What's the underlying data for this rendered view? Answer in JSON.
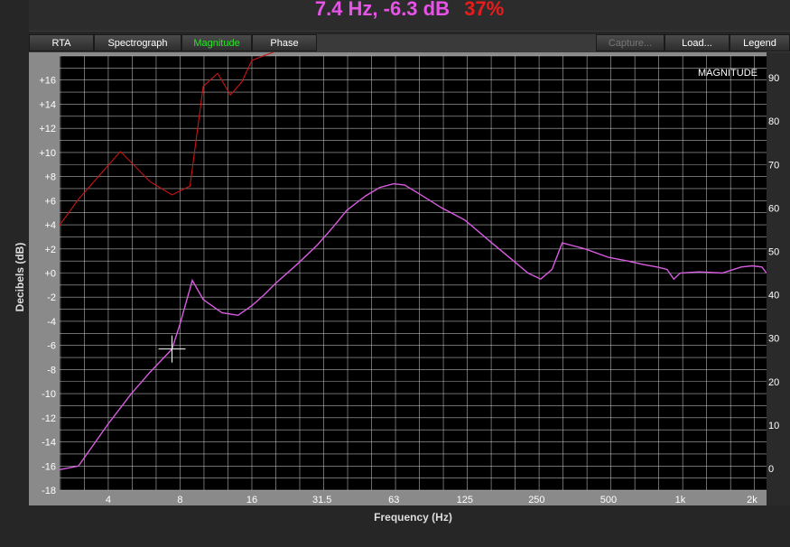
{
  "readout": {
    "freq_db": "7.4 Hz, -6.3 dB",
    "percent": "37%"
  },
  "tabs": [
    {
      "label": "RTA",
      "state": "normal"
    },
    {
      "label": "Spectrograph",
      "state": "normal"
    },
    {
      "label": "Magnitude",
      "state": "active"
    },
    {
      "label": "Phase",
      "state": "normal"
    },
    {
      "label": "Capture...",
      "state": "disabled"
    },
    {
      "label": "Load...",
      "state": "normal"
    },
    {
      "label": "Legend",
      "state": "normal"
    }
  ],
  "plot": {
    "title": "MAGNITUDE",
    "xlabel": "Frequency (Hz)",
    "ylabel": "Decibels (dB)"
  },
  "colors": {
    "magnitude": "#d85ce0",
    "coherence": "#c81414",
    "grid": "#d0d0d0",
    "plot_bg": "#000000",
    "cursor": "#ffffff"
  },
  "chart_data": {
    "type": "line",
    "x_scale": "log",
    "xlim": [
      2.5,
      2300
    ],
    "ylim": [
      -18,
      18
    ],
    "y2lim": [
      -5,
      95
    ],
    "x_tick_labels": [
      "4",
      "8",
      "16",
      "31.5",
      "63",
      "125",
      "250",
      "500",
      "1k",
      "2k"
    ],
    "x_tick_values": [
      4,
      8,
      16,
      31.5,
      63,
      125,
      250,
      500,
      1000,
      2000
    ],
    "y_ticks": [
      16,
      14,
      12,
      10,
      8,
      6,
      4,
      2,
      0,
      -2,
      -4,
      -6,
      -8,
      -10,
      -12,
      -14,
      -16,
      -18
    ],
    "y_tick_labels": [
      "+16",
      "+14",
      "+12",
      "+10",
      "+8",
      "+6",
      "+4",
      "+2",
      "+0",
      "-2",
      "-4",
      "-6",
      "-8",
      "-10",
      "-12",
      "-14",
      "-16",
      "-18"
    ],
    "y2_ticks": [
      90,
      80,
      70,
      60,
      50,
      40,
      30,
      20,
      10,
      0
    ],
    "y2_tick_labels": [
      "90",
      "80",
      "70",
      "60",
      "50",
      "40",
      "30",
      "20",
      "10",
      "0"
    ],
    "grid": true,
    "cursor": {
      "x": 7.4,
      "y": -6.3
    },
    "series": [
      {
        "axis": "left",
        "x": [
          2.5,
          3,
          4,
          5,
          6,
          7.4,
          8,
          9,
          10,
          12,
          13,
          14,
          16,
          18,
          20,
          25,
          30,
          35,
          40,
          48,
          55,
          63,
          70,
          80,
          100,
          125,
          160,
          200,
          230,
          260,
          290,
          320,
          400,
          500,
          600,
          700,
          800,
          880,
          940,
          1000,
          1200,
          1500,
          1800,
          2000,
          2200,
          2300
        ],
        "y": [
          -16.3,
          -16.0,
          -12.5,
          -10.0,
          -8.2,
          -6.3,
          -4.2,
          -0.6,
          -2.2,
          -3.3,
          -3.4,
          -3.5,
          -2.7,
          -1.8,
          -0.9,
          0.8,
          2.3,
          3.8,
          5.2,
          6.4,
          7.1,
          7.4,
          7.3,
          6.6,
          5.4,
          4.4,
          2.6,
          1.0,
          0.0,
          -0.5,
          0.3,
          2.5,
          2.0,
          1.3,
          1.0,
          0.7,
          0.5,
          0.3,
          -0.5,
          0.0,
          0.1,
          0.0,
          0.5,
          0.6,
          0.5,
          0.0
        ]
      },
      {
        "axis": "right",
        "x": [
          2.5,
          3,
          4.5,
          6,
          7.4,
          8.8,
          10,
          11.5,
          13,
          14.5,
          16,
          20,
          30,
          50,
          100,
          300,
          1000,
          2300
        ],
        "y": [
          56,
          62,
          73,
          66,
          63,
          65,
          88,
          91,
          86,
          89,
          94,
          96,
          97,
          98,
          98,
          98,
          98,
          98
        ]
      }
    ]
  }
}
